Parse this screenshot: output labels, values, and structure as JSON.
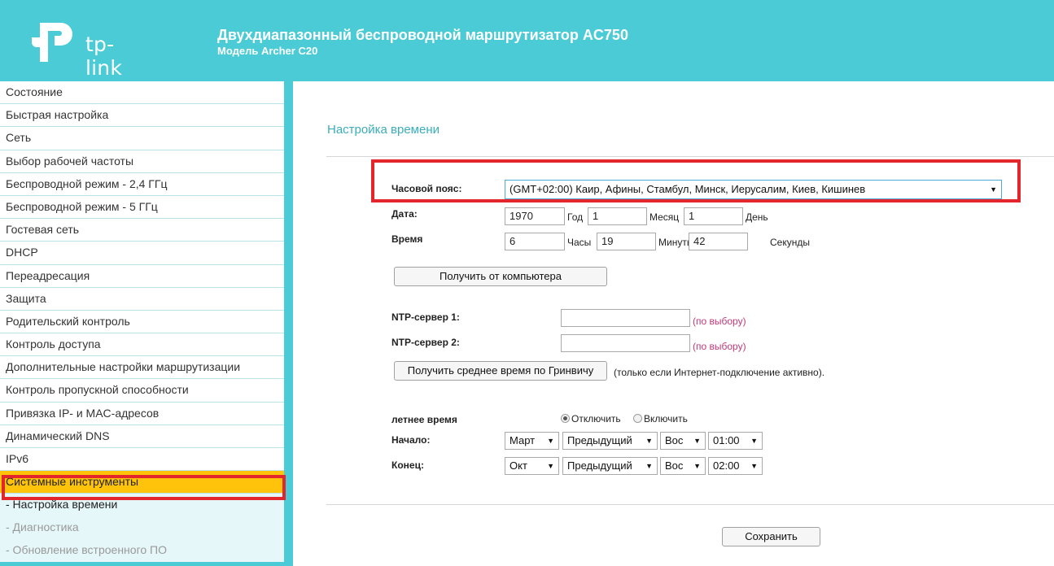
{
  "header": {
    "logo_text": "tp-link",
    "title": "Двухдиапазонный беспроводной маршрутизатор AC750",
    "model": "Модель Archer C20"
  },
  "sidebar": {
    "items": [
      {
        "label": "Состояние"
      },
      {
        "label": "Быстрая настройка"
      },
      {
        "label": "Сеть"
      },
      {
        "label": "Выбор рабочей частоты"
      },
      {
        "label": "Беспроводной режим - 2,4 ГГц"
      },
      {
        "label": "Беспроводной режим - 5 ГГц"
      },
      {
        "label": "Гостевая сеть"
      },
      {
        "label": "DHCP"
      },
      {
        "label": "Переадресация"
      },
      {
        "label": "Защита"
      },
      {
        "label": "Родительский контроль"
      },
      {
        "label": "Контроль доступа"
      },
      {
        "label": "Дополнительные настройки маршрутизации"
      },
      {
        "label": "Контроль пропускной способности"
      },
      {
        "label": "Привязка IP- и MAC-адресов"
      },
      {
        "label": "Динамический DNS"
      },
      {
        "label": "IPv6"
      },
      {
        "label": "Системные инструменты"
      }
    ],
    "subitems": [
      {
        "label": "- Настройка времени"
      },
      {
        "label": "- Диагностика"
      },
      {
        "label": "- Обновление встроенного ПО"
      }
    ]
  },
  "page": {
    "title": "Настройка времени",
    "timezone": {
      "label": "Часовой пояс:",
      "value": "(GMT+02:00) Каир, Афины, Стамбул, Минск, Иерусалим, Киев, Кишинев"
    },
    "date": {
      "label": "Дата:",
      "year": "1970",
      "year_label": "Год",
      "month": "1",
      "month_label": "Месяц",
      "day": "1",
      "day_label": "День"
    },
    "time": {
      "label": "Время",
      "hours": "6",
      "hours_label": "Часы",
      "minutes": "19",
      "minutes_label": "Минуты",
      "seconds": "42",
      "seconds_label": "Секунды"
    },
    "get_from_pc_button": "Получить от компьютера",
    "ntp1": {
      "label": "NTP-сервер 1:",
      "value": "",
      "note": "(по выбору)"
    },
    "ntp2": {
      "label": "NTP-сервер 2:",
      "value": "",
      "note": "(по выбору)"
    },
    "gmt_button": "Получить среднее время по Гринвичу",
    "gmt_note": "(только если Интернет-подключение активно).",
    "dst": {
      "label": "летнее время",
      "off_label": "Отключить",
      "on_label": "Включить",
      "selected": "off"
    },
    "start": {
      "label": "Начало:",
      "month": "Март",
      "week": "Предыдущий",
      "day": "Вос",
      "time": "01:00"
    },
    "end": {
      "label": "Конец:",
      "month": "Окт",
      "week": "Предыдущий",
      "day": "Вос",
      "time": "02:00"
    },
    "save_button": "Сохранить"
  }
}
